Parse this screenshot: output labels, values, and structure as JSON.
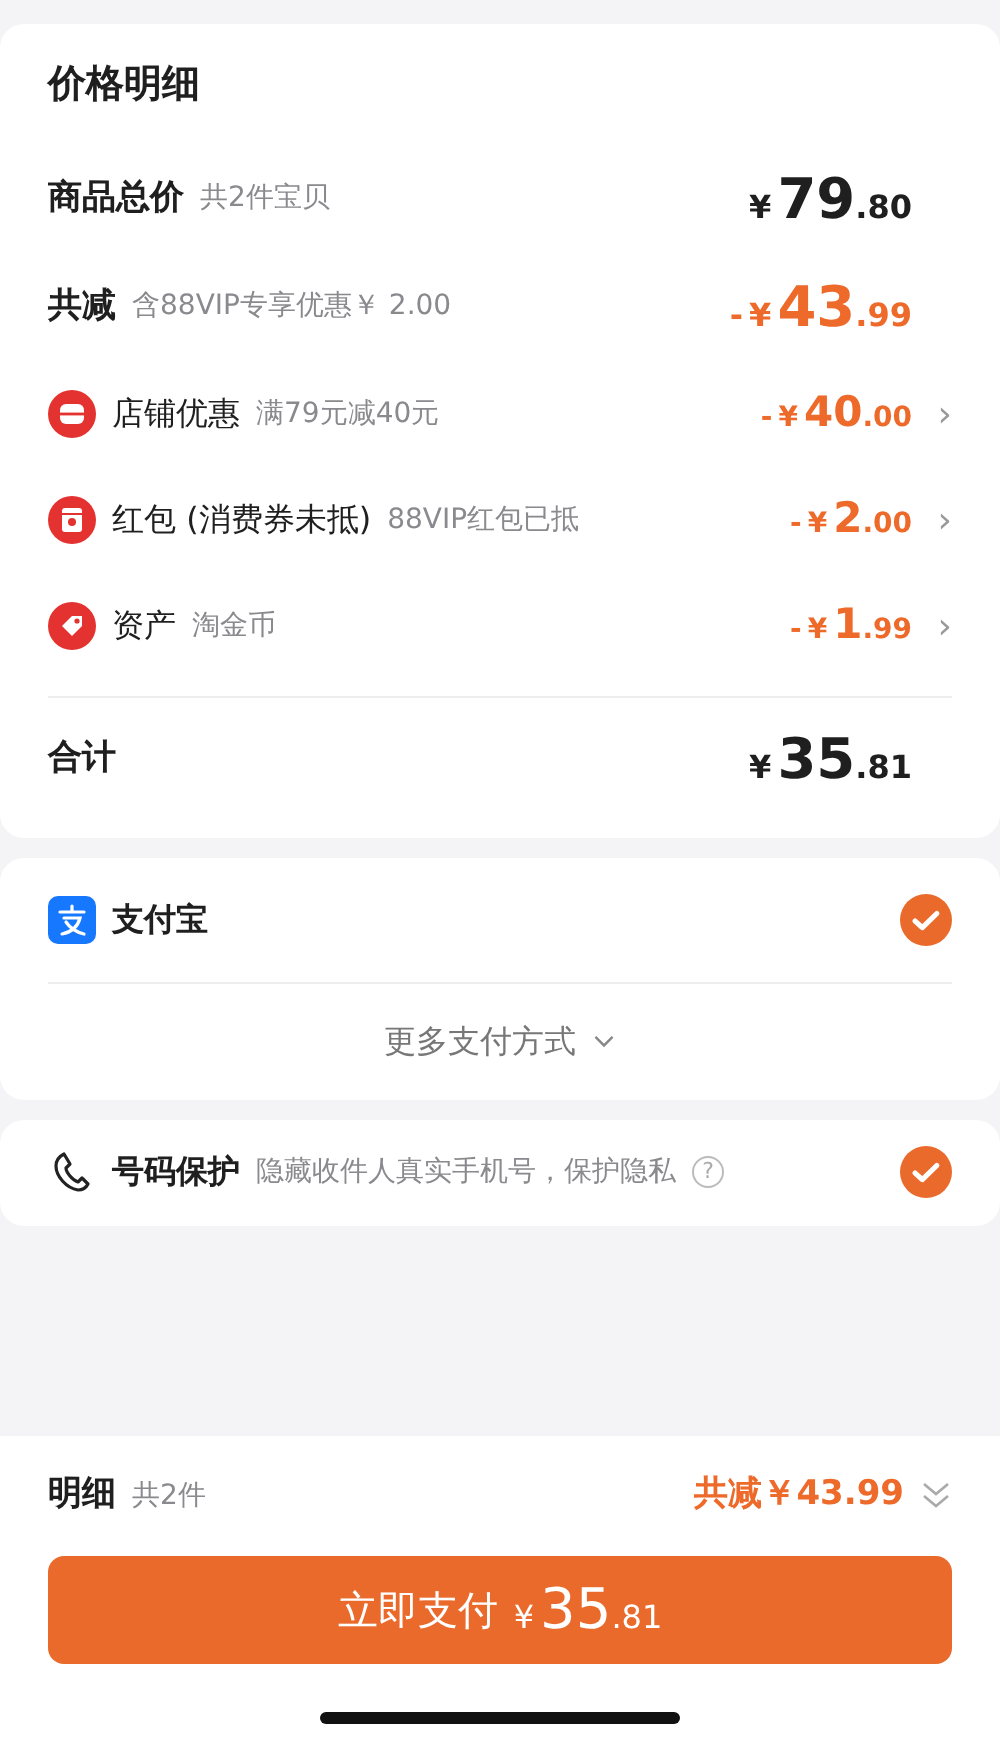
{
  "price_detail": {
    "title": "价格明细",
    "subtotal": {
      "label": "商品总价",
      "note": "共2件宝贝",
      "price": {
        "currency": "¥",
        "int": "79",
        "dec": ".80"
      }
    },
    "discount_total": {
      "label": "共减",
      "note": "含88VIP专享优惠￥ 2.00",
      "price": {
        "sign": "-",
        "currency": "¥",
        "int": "43",
        "dec": ".99"
      }
    },
    "discounts": [
      {
        "kind": "store",
        "label": "店铺优惠",
        "note": "满79元减40元",
        "price": {
          "sign": "-",
          "currency": "¥",
          "int": "40",
          "dec": ".00"
        },
        "chevron": "›"
      },
      {
        "kind": "redpacket",
        "label": "红包 (消费券未抵)",
        "note": "88VIP红包已抵",
        "price": {
          "sign": "-",
          "currency": "¥",
          "int": "2",
          "dec": ".00"
        },
        "chevron": "›"
      },
      {
        "kind": "asset",
        "label": "资产",
        "note": "淘金币",
        "price": {
          "sign": "-",
          "currency": "¥",
          "int": "1",
          "dec": ".99"
        },
        "chevron": "›"
      }
    ],
    "total": {
      "label": "合计",
      "price": {
        "currency": "¥",
        "int": "35",
        "dec": ".81"
      }
    }
  },
  "payment": {
    "method": {
      "label": "支付宝",
      "checked": true
    },
    "more": "更多支付方式"
  },
  "privacy": {
    "label": "号码保护",
    "note": "隐藏收件人真实手机号，保护隐私",
    "help": "?",
    "checked": true
  },
  "footer": {
    "label": "明细",
    "count": "共2件",
    "saving": "共减￥43.99",
    "pay_button": {
      "label": "立即支付",
      "price": {
        "currency": "¥",
        "int": "35",
        "dec": ".81"
      }
    }
  }
}
